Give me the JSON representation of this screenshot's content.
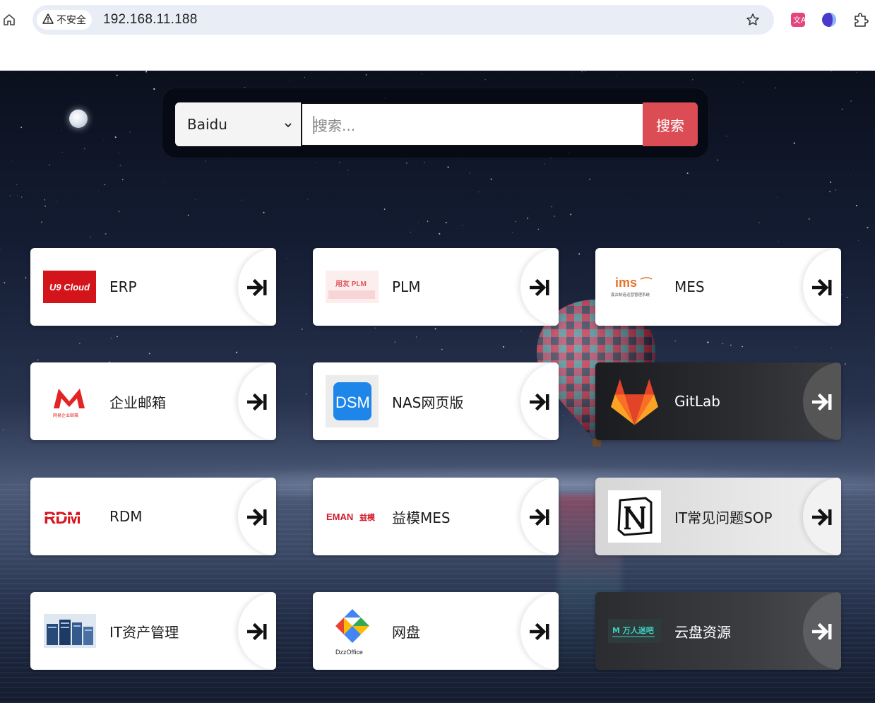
{
  "browser": {
    "security_label": "不安全",
    "url": "192.168.11.188"
  },
  "search": {
    "engine_selected": "Baidu",
    "placeholder": "搜索...",
    "button_label": "搜索"
  },
  "cards": [
    {
      "label": "ERP",
      "logo_text": "U9 Cloud",
      "theme": "light"
    },
    {
      "label": "PLM",
      "logo_text": "用友 PLM",
      "theme": "light"
    },
    {
      "label": "MES",
      "logo_text": "ims",
      "logo_sub": "鑫古制造运营管理系统",
      "theme": "light"
    },
    {
      "label": "企业邮箱",
      "logo_text": "M",
      "logo_sub": "网易企业邮箱",
      "theme": "light"
    },
    {
      "label": "NAS网页版",
      "logo_text": "DSM",
      "theme": "light"
    },
    {
      "label": "GitLab",
      "logo_text": "gitlab-fox",
      "theme": "dark"
    },
    {
      "label": "RDM",
      "logo_text": "RDM",
      "theme": "light"
    },
    {
      "label": "益模MES",
      "logo_text": "EMAN 益模",
      "theme": "light"
    },
    {
      "label": "IT常见问题SOP",
      "logo_text": "N",
      "theme": "gray"
    },
    {
      "label": "IT资产管理",
      "logo_text": "server-rack",
      "theme": "light"
    },
    {
      "label": "网盘",
      "logo_text": "DzzOffice",
      "theme": "light"
    },
    {
      "label": "云盘资源",
      "logo_text": "M 万人迷吧",
      "theme": "dark2"
    }
  ],
  "colors": {
    "search_button": "#dc4c55",
    "u9_red": "#d4141b",
    "dsm_blue": "#1d86e8",
    "gitlab_orange": "#fc6d26"
  }
}
